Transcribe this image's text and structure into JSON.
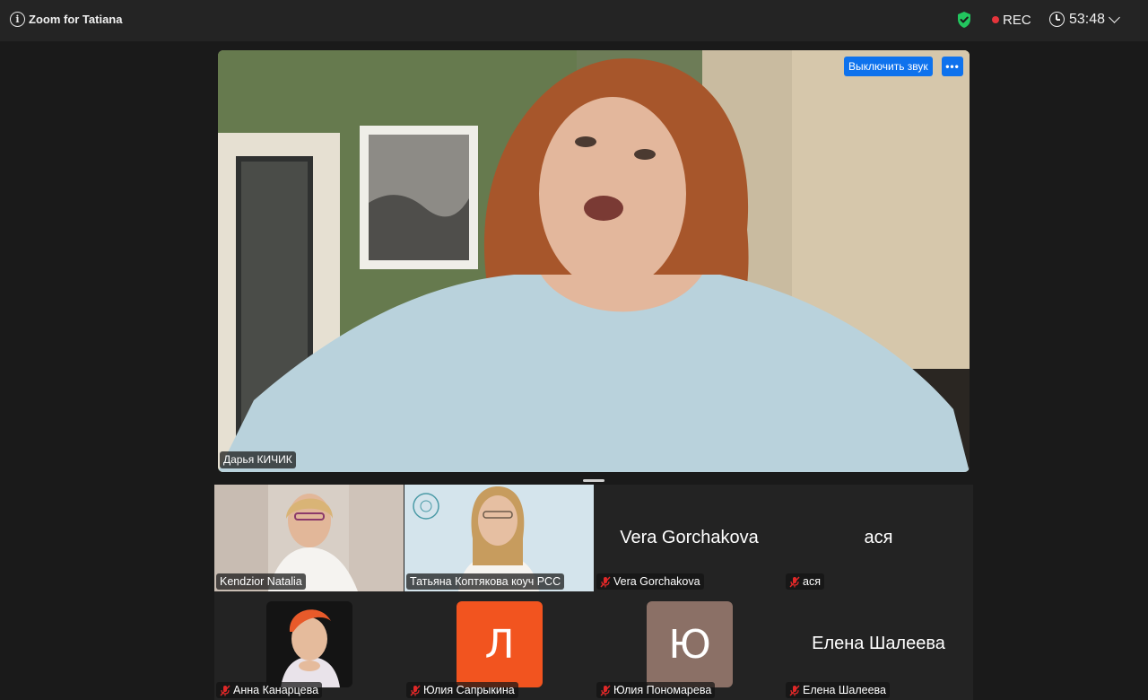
{
  "header": {
    "app_title": "Zoom for Tatiana",
    "rec_label": "REC",
    "timer": "53:48",
    "icons": [
      "info-icon",
      "shield-check-icon",
      "clock-icon",
      "chevron-down-icon"
    ],
    "colors": {
      "shield": "#22c55e",
      "rec_dot": "#e5343b"
    }
  },
  "main_video": {
    "speaker_name": "Дарья КИЧИК",
    "unmute_label": "Выключить звук",
    "more_label": "•••",
    "colors": {
      "button": "#0e72ed"
    }
  },
  "gallery": {
    "tiles": [
      {
        "name": "Kendzior Natalia",
        "type": "video",
        "muted": false
      },
      {
        "name": "Татьяна Коптякова коуч PCC",
        "type": "video",
        "muted": false
      },
      {
        "name": "Vera Gorchakova",
        "display": "Vera Gorchakova",
        "type": "name",
        "muted": true
      },
      {
        "name": "ася",
        "display": "ася",
        "type": "name",
        "muted": true
      },
      {
        "name": "Анна Канарцева",
        "type": "photo",
        "muted": true
      },
      {
        "name": "Юлия Сапрыкина",
        "type": "avatar",
        "initial": "Л",
        "color": "#f2541f",
        "muted": true
      },
      {
        "name": "Юлия Пономарева",
        "type": "avatar",
        "initial": "Ю",
        "color": "#8b7066",
        "muted": true
      },
      {
        "name": "Елена Шалеева",
        "display": "Елена Шалеева",
        "type": "name",
        "muted": true
      }
    ]
  }
}
